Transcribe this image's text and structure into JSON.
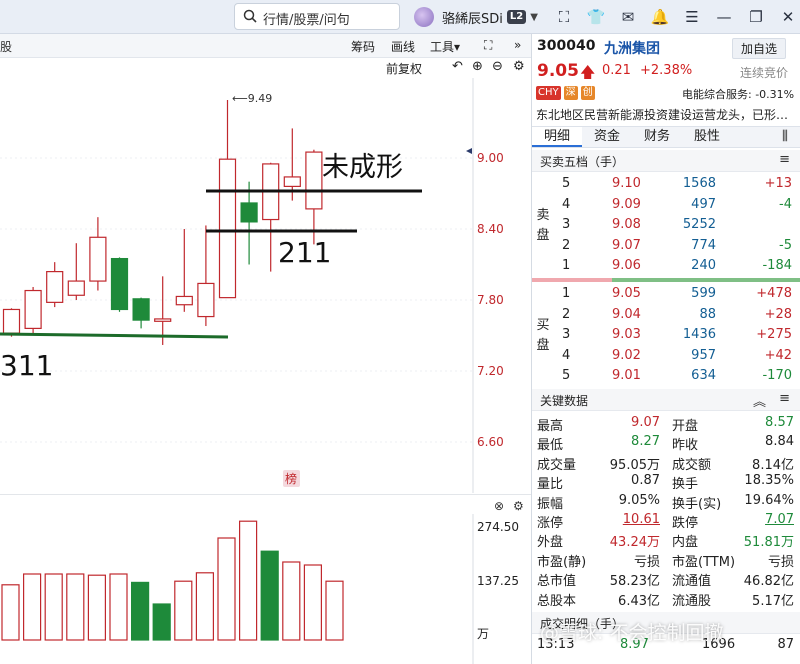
{
  "topbar": {
    "search_placeholder": "行情/股票/问句",
    "user_name": "骆絺辰SDi",
    "level_badge": "L2",
    "icons": [
      "fullscreen-icon",
      "shirt-icon",
      "mail-icon",
      "bell-icon",
      "menu-icon",
      "minimize-icon",
      "restore-icon",
      "close-icon"
    ]
  },
  "chart_toolbar": {
    "stock_tab": "股",
    "chips": "筹码",
    "draw": "画线",
    "tools": "工具▾",
    "adjust": "前复权"
  },
  "kline": {
    "price_labels": [
      "9.00",
      "8.40",
      "7.80",
      "7.20",
      "6.60"
    ],
    "max_label": "9.49",
    "annotation_top": "未成形",
    "annotation_mid": "211",
    "annotation_left": "311",
    "badge": "榜",
    "candles": [
      {
        "o": 7.52,
        "c": 7.72,
        "h": 7.73,
        "l": 7.49
      },
      {
        "o": 7.56,
        "c": 7.88,
        "h": 7.91,
        "l": 7.52
      },
      {
        "o": 7.78,
        "c": 8.04,
        "h": 8.12,
        "l": 7.74
      },
      {
        "o": 7.84,
        "c": 7.96,
        "h": 8.28,
        "l": 7.8
      },
      {
        "o": 7.96,
        "c": 8.33,
        "h": 8.5,
        "l": 7.88
      },
      {
        "o": 8.15,
        "c": 7.72,
        "h": 8.16,
        "l": 7.7
      },
      {
        "o": 7.81,
        "c": 7.63,
        "h": 7.82,
        "l": 7.56
      },
      {
        "o": 7.62,
        "c": 7.64,
        "h": 8.0,
        "l": 7.42
      },
      {
        "o": 7.76,
        "c": 7.83,
        "h": 8.4,
        "l": 7.7
      },
      {
        "o": 7.66,
        "c": 7.94,
        "h": 8.43,
        "l": 7.58
      },
      {
        "o": 7.82,
        "c": 8.99,
        "h": 9.49,
        "l": 7.82
      },
      {
        "o": 8.62,
        "c": 8.46,
        "h": 8.8,
        "l": 8.1
      },
      {
        "o": 8.48,
        "c": 8.95,
        "h": 8.96,
        "l": 8.04
      },
      {
        "o": 8.76,
        "c": 8.84,
        "h": 9.25,
        "l": 8.64
      },
      {
        "o": 8.57,
        "c": 9.05,
        "h": 9.07,
        "l": 8.27
      }
    ]
  },
  "volume": {
    "labels": [
      "274.50",
      "137.25",
      "万"
    ],
    "values": [
      92,
      110,
      110,
      110,
      108,
      110,
      96,
      60,
      98,
      112,
      170,
      198,
      148,
      130,
      125,
      98
    ],
    "up": [
      true,
      true,
      true,
      true,
      true,
      true,
      false,
      false,
      true,
      true,
      true,
      true,
      false,
      true,
      true,
      true
    ]
  },
  "quote": {
    "code": "300040",
    "name": "九洲集团",
    "add_watch": "加自选",
    "price": "9.05",
    "change": "0.21",
    "pct": "+2.38%",
    "session": "连续竞价",
    "tags": [
      "CHY",
      "深",
      "创"
    ],
    "sector": "电能综合服务: -0.31%",
    "news": "东北地区民营新能源投资建设运营龙头，已形…",
    "tabs": [
      "明细",
      "资金",
      "财务",
      "股性"
    ]
  },
  "orderbook": {
    "title": "买卖五档（手）",
    "sell_label": "卖盘",
    "buy_label": "买盘",
    "sell": [
      {
        "lv": "5",
        "pr": "9.10",
        "vol": "1568",
        "dv": "+13"
      },
      {
        "lv": "4",
        "pr": "9.09",
        "vol": "497",
        "dv": "-4"
      },
      {
        "lv": "3",
        "pr": "9.08",
        "vol": "5252",
        "dv": ""
      },
      {
        "lv": "2",
        "pr": "9.07",
        "vol": "774",
        "dv": "-5"
      },
      {
        "lv": "1",
        "pr": "9.06",
        "vol": "240",
        "dv": "-184"
      }
    ],
    "buy": [
      {
        "lv": "1",
        "pr": "9.05",
        "vol": "599",
        "dv": "+478"
      },
      {
        "lv": "2",
        "pr": "9.04",
        "vol": "88",
        "dv": "+28"
      },
      {
        "lv": "3",
        "pr": "9.03",
        "vol": "1436",
        "dv": "+275"
      },
      {
        "lv": "4",
        "pr": "9.02",
        "vol": "957",
        "dv": "+42"
      },
      {
        "lv": "5",
        "pr": "9.01",
        "vol": "634",
        "dv": "-170"
      }
    ]
  },
  "keydata": {
    "title": "关键数据",
    "rows": [
      {
        "k1": "最高",
        "v1": "9.07",
        "c1": "red",
        "k2": "开盘",
        "v2": "8.57",
        "c2": "green"
      },
      {
        "k1": "最低",
        "v1": "8.27",
        "c1": "green",
        "k2": "昨收",
        "v2": "8.84",
        "c2": "blk"
      },
      {
        "k1": "成交量",
        "v1": "95.05万",
        "c1": "blk",
        "k2": "成交额",
        "v2": "8.14亿",
        "c2": "blk"
      },
      {
        "k1": "量比",
        "v1": "0.87",
        "c1": "blk",
        "k2": "换手",
        "v2": "18.35%",
        "c2": "blk"
      },
      {
        "k1": "振幅",
        "v1": "9.05%",
        "c1": "blk",
        "k2": "换手(实)",
        "v2": "19.64%",
        "c2": "blk"
      },
      {
        "k1": "涨停",
        "v1": "10.61",
        "c1": "red-u",
        "k2": "跌停",
        "v2": "7.07",
        "c2": "green-u"
      },
      {
        "k1": "外盘",
        "v1": "43.24万",
        "c1": "red",
        "k2": "内盘",
        "v2": "51.81万",
        "c2": "green"
      },
      {
        "k1": "市盈(静)",
        "v1": "亏损",
        "c1": "blk",
        "k2": "市盈(TTM)",
        "v2": "亏损",
        "c2": "blk"
      },
      {
        "k1": "总市值",
        "v1": "58.23亿",
        "c1": "blk",
        "k2": "流通值",
        "v2": "46.82亿",
        "c2": "blk"
      },
      {
        "k1": "总股本",
        "v1": "6.43亿",
        "c1": "blk",
        "k2": "流通股",
        "v2": "5.17亿",
        "c2": "blk"
      }
    ]
  },
  "trades": {
    "title": "成交明细（手）",
    "row": {
      "time": "13:13",
      "price": "8.97",
      "vol": "1696",
      "n": "87"
    }
  },
  "watermark": "@雪球: 不会控制回撤",
  "colors": {
    "up": "#c0282d",
    "down": "#1e8a3a",
    "accent": "#1a55a8"
  }
}
